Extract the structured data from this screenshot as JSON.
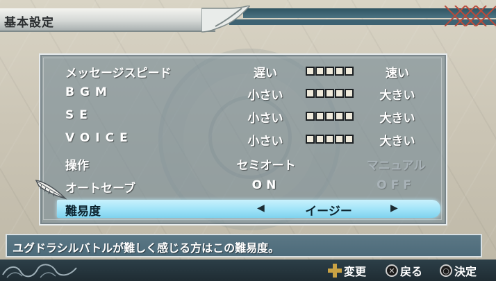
{
  "header": {
    "title": "基本設定"
  },
  "settings": [
    {
      "label": "メッセージスピード",
      "low": "遅い",
      "high": "速い",
      "level": 5,
      "max": 5
    },
    {
      "label": "BGM",
      "low": "小さい",
      "high": "大きい",
      "level": 5,
      "max": 5
    },
    {
      "label": "SE",
      "low": "小さい",
      "high": "大きい",
      "level": 5,
      "max": 5
    },
    {
      "label": "VOICE",
      "low": "小さい",
      "high": "大きい",
      "level": 5,
      "max": 5
    }
  ],
  "operation": {
    "label": "操作",
    "selected": "セミオート",
    "other": "マニュアル"
  },
  "autosave": {
    "label": "オートセーブ",
    "selected": "ON",
    "other": "OFF"
  },
  "difficulty": {
    "label": "難易度",
    "value": "イージー",
    "left_arrow": "◀",
    "right_arrow": "▶"
  },
  "description": "ユグドラシルバトルが難しく感じる方はこの難易度。",
  "footer": {
    "change_label": "変更",
    "back_label": "戻る",
    "confirm_label": "決定",
    "back_button_icon": "cross-button-icon",
    "confirm_button_icon": "circle-button-icon",
    "change_button_icon": "dpad-icon"
  },
  "colors": {
    "highlight": "#9fe3f8",
    "panel": "#768a96",
    "footer": "#1f2c33"
  }
}
